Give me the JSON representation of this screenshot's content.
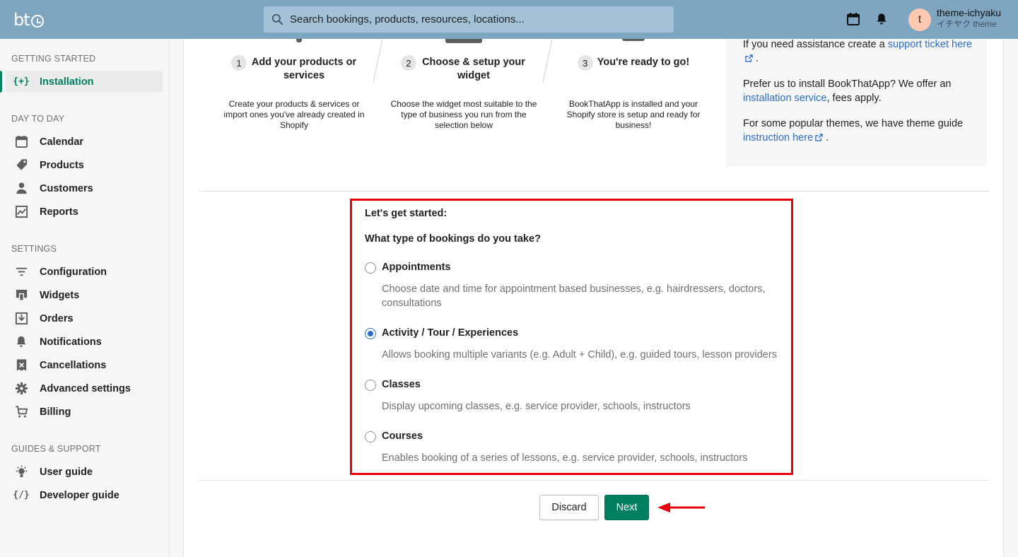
{
  "topbar": {
    "logo_text": "bt",
    "search_placeholder": "Search bookings, products, resources, locations...",
    "user_initial": "t",
    "user_name": "theme-ichyaku",
    "shop_name": "イチヤク theme"
  },
  "sidebar": {
    "sections": [
      {
        "title": "GETTING STARTED",
        "items": [
          {
            "label": "Installation",
            "icon": "code-braces-icon",
            "active": true
          }
        ]
      },
      {
        "title": "DAY TO DAY",
        "items": [
          {
            "label": "Calendar",
            "icon": "calendar-icon"
          },
          {
            "label": "Products",
            "icon": "tag-icon"
          },
          {
            "label": "Customers",
            "icon": "person-icon"
          },
          {
            "label": "Reports",
            "icon": "chart-icon"
          }
        ]
      },
      {
        "title": "SETTINGS",
        "items": [
          {
            "label": "Configuration",
            "icon": "filter-icon"
          },
          {
            "label": "Widgets",
            "icon": "widget-icon"
          },
          {
            "label": "Orders",
            "icon": "inbox-icon"
          },
          {
            "label": "Notifications",
            "icon": "bell-icon"
          },
          {
            "label": "Cancellations",
            "icon": "receipt-icon"
          },
          {
            "label": "Advanced settings",
            "icon": "gear-icon"
          },
          {
            "label": "Billing",
            "icon": "cart-icon"
          }
        ]
      },
      {
        "title": "GUIDES & SUPPORT",
        "items": [
          {
            "label": "User guide",
            "icon": "lightbulb-icon"
          },
          {
            "label": "Developer guide",
            "icon": "code-icon"
          }
        ]
      }
    ]
  },
  "steps": [
    {
      "num": "1",
      "title": "Add your products or services",
      "desc": "Create your products & services or import ones you've already created in Shopify"
    },
    {
      "num": "2",
      "title": "Choose & setup your widget",
      "desc": "Choose the widget most suitable to the type of business you run from the selection below"
    },
    {
      "num": "3",
      "title": "You're ready to go!",
      "desc": "BookThatApp is installed and your Shopify store is setup and ready for business!"
    }
  ],
  "help": {
    "p1_text": "If you need assistance create a ",
    "p1_link": "support ticket here",
    "p1_end": ".",
    "p2_text": "Prefer us to install BookThatApp? We offer an ",
    "p2_link": "installation service",
    "p2_end": ", fees apply.",
    "p3_text": "For some popular themes, we have theme guide ",
    "p3_link": "instruction here",
    "p3_end": "."
  },
  "form": {
    "heading": "Let's get started:",
    "question": "What type of bookings do you take?",
    "options": [
      {
        "label": "Appointments",
        "desc": "Choose date and time for appointment based businesses, e.g. hairdressers, doctors, consultations",
        "selected": false
      },
      {
        "label": "Activity / Tour / Experiences",
        "desc": "Allows booking multiple variants (e.g. Adult + Child), e.g. guided tours, lesson providers",
        "selected": true
      },
      {
        "label": "Classes",
        "desc": "Display upcoming classes, e.g. service provider, schools, instructors",
        "selected": false
      },
      {
        "label": "Courses",
        "desc": "Enables booking of a series of lessons, e.g. service provider, schools, instructors",
        "selected": false
      }
    ]
  },
  "actions": {
    "discard_label": "Discard",
    "next_label": "Next"
  },
  "colors": {
    "accent": "#008060",
    "topbar": "#7fa6c0",
    "highlight": "#e8000b",
    "link": "#2c6ecb"
  }
}
